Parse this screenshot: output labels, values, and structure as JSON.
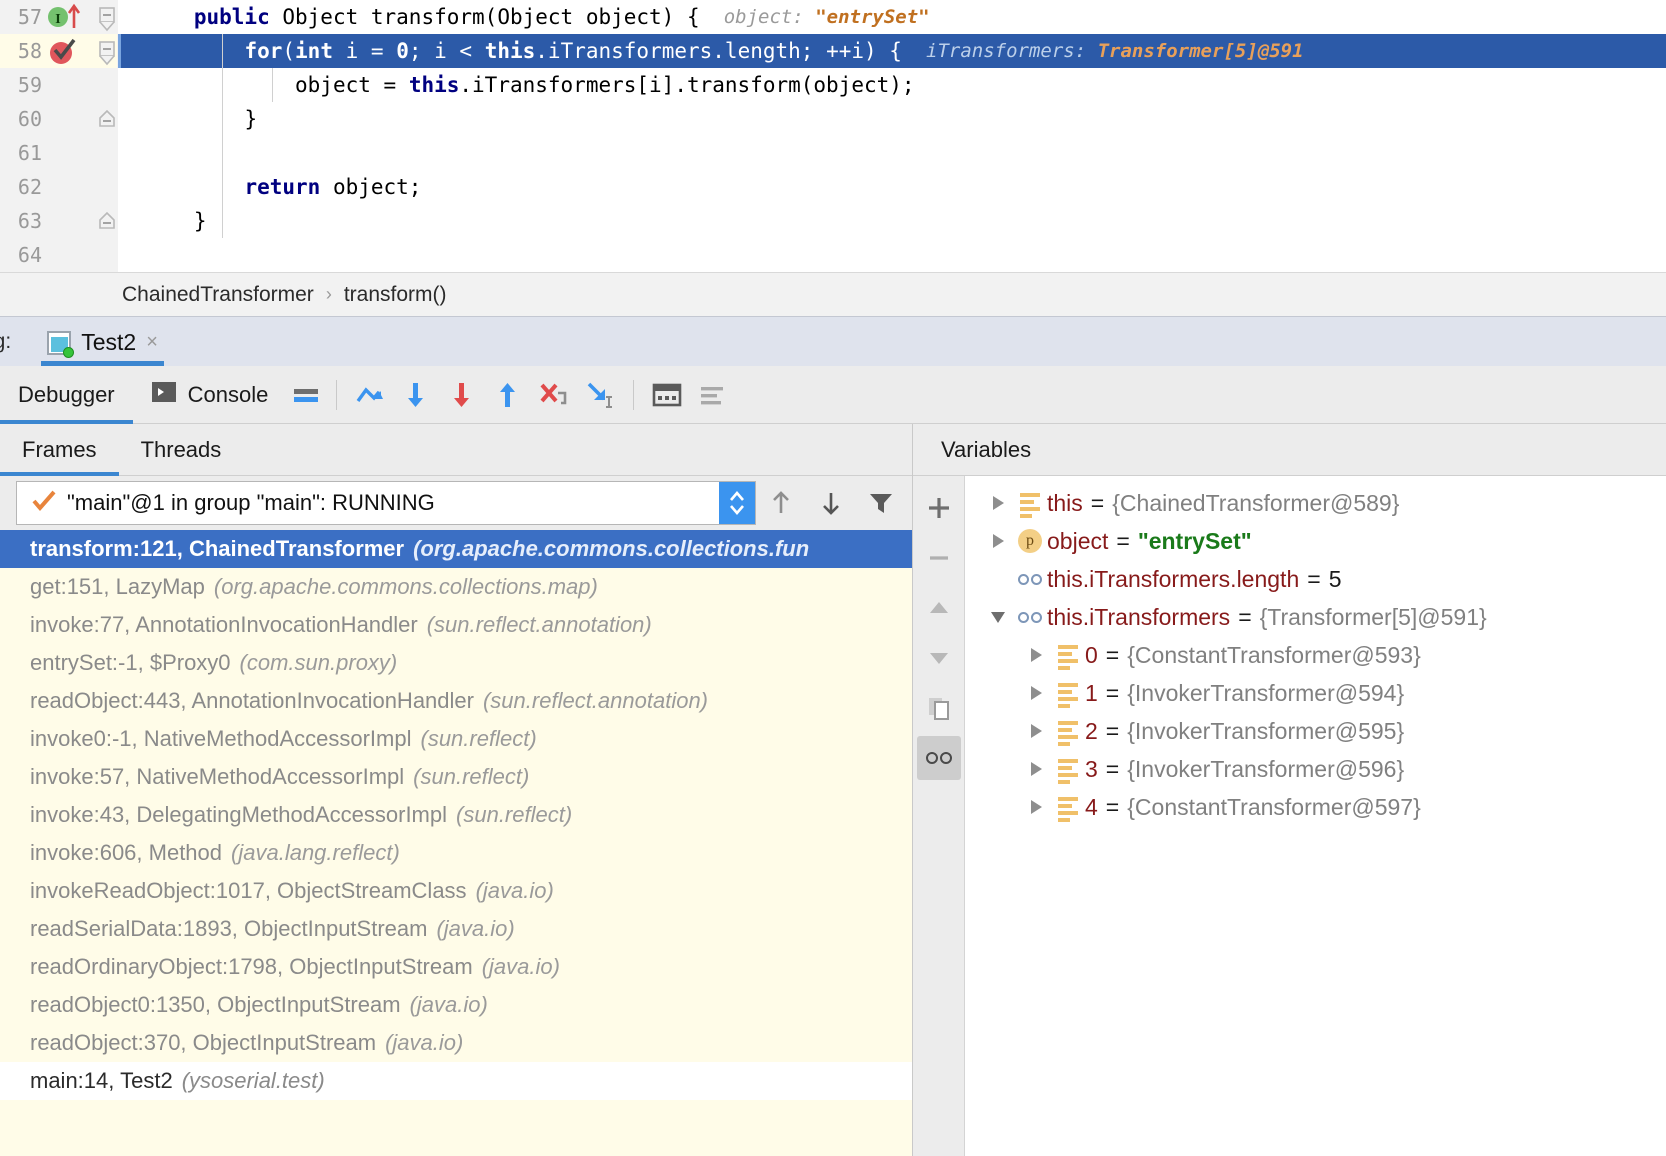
{
  "editor": {
    "lines": [
      {
        "no": "57",
        "exec": false,
        "selected": false,
        "indent": 0,
        "gutter_icon": "execution-point-icon",
        "segments": [
          {
            "t": "public ",
            "c": "kw"
          },
          {
            "t": "Object transform(",
            "c": ""
          },
          {
            "t": "Object",
            "c": ""
          },
          {
            "t": " object) { ",
            "c": ""
          }
        ],
        "inlay_label": "object:",
        "inlay_value": "\"entrySet\""
      },
      {
        "no": "58",
        "exec": true,
        "selected": true,
        "indent": 1,
        "gutter_icon": "breakpoint-verified-icon",
        "segments": [
          {
            "t": "for",
            "c": "kw"
          },
          {
            "t": "(",
            "c": ""
          },
          {
            "t": "int",
            "c": "kw"
          },
          {
            "t": " i = ",
            "c": ""
          },
          {
            "t": "0",
            "c": "kw"
          },
          {
            "t": "; i < ",
            "c": ""
          },
          {
            "t": "this",
            "c": "kw"
          },
          {
            "t": ".iTransformers.length; ++i) { ",
            "c": ""
          }
        ],
        "inlay_label": "iTransformers:",
        "inlay_value": "Transformer[5]@591"
      },
      {
        "no": "59",
        "exec": false,
        "selected": false,
        "indent": 2,
        "gutter_icon": "",
        "segments": [
          {
            "t": "object = ",
            "c": ""
          },
          {
            "t": "this",
            "c": "kw"
          },
          {
            "t": ".iTransformers[i].transform(object);",
            "c": ""
          }
        ],
        "inlay_label": "",
        "inlay_value": ""
      },
      {
        "no": "60",
        "exec": false,
        "selected": false,
        "indent": 1,
        "gutter_icon": "fold-collapse-icon",
        "segments": [
          {
            "t": "}",
            "c": ""
          }
        ],
        "inlay_label": "",
        "inlay_value": ""
      },
      {
        "no": "61",
        "exec": false,
        "selected": false,
        "indent": 0,
        "gutter_icon": "",
        "segments": [],
        "inlay_label": "",
        "inlay_value": ""
      },
      {
        "no": "62",
        "exec": false,
        "selected": false,
        "indent": 1,
        "gutter_icon": "",
        "segments": [
          {
            "t": "return",
            "c": "kw"
          },
          {
            "t": " object;",
            "c": ""
          }
        ],
        "inlay_label": "",
        "inlay_value": ""
      },
      {
        "no": "63",
        "exec": false,
        "selected": false,
        "indent": 0,
        "gutter_icon": "fold-collapse-icon",
        "segments": [
          {
            "t": "}",
            "c": ""
          }
        ],
        "inlay_label": "",
        "inlay_value": ""
      },
      {
        "no": "64",
        "exec": false,
        "selected": false,
        "indent": 0,
        "gutter_icon": "",
        "segments": [],
        "inlay_label": "",
        "inlay_value": ""
      }
    ]
  },
  "breadcrumb": {
    "class_name": "ChainedTransformer",
    "separator": "›",
    "method_name": "transform()"
  },
  "debug_tabbar": {
    "label": "ug:",
    "tab_title": "Test2",
    "close_glyph": "×"
  },
  "toolbar": {
    "tabs": [
      {
        "label": "Debugger",
        "active": true
      },
      {
        "label": "Console",
        "active": false
      }
    ],
    "buttons": [
      {
        "name": "mute-breakpoints-button",
        "title": "Mute Breakpoints"
      },
      {
        "name": "step-over-button",
        "title": "Step Over"
      },
      {
        "name": "step-into-button",
        "title": "Step Into"
      },
      {
        "name": "force-step-into-button",
        "title": "Force Step Into"
      },
      {
        "name": "step-out-button",
        "title": "Step Out"
      },
      {
        "name": "drop-frame-button",
        "title": "Drop Frame"
      },
      {
        "name": "run-to-cursor-button",
        "title": "Run to Cursor"
      },
      {
        "name": "evaluate-expression-button",
        "title": "Evaluate Expression"
      },
      {
        "name": "settings-button",
        "title": "Settings"
      }
    ]
  },
  "frames_pane": {
    "tabs": [
      {
        "label": "Frames",
        "active": true
      },
      {
        "label": "Threads",
        "active": false
      }
    ],
    "thread_selector": {
      "value": "\"main\"@1 in group \"main\": RUNNING"
    },
    "thread_buttons": [
      {
        "name": "frames-up-button"
      },
      {
        "name": "frames-down-button"
      },
      {
        "name": "frames-filter-button"
      }
    ],
    "frames": [
      {
        "method": "transform:121, ChainedTransformer",
        "pkg": "(org.apache.commons.collections.fun",
        "selected": true,
        "last": false
      },
      {
        "method": "get:151, LazyMap",
        "pkg": "(org.apache.commons.collections.map)",
        "selected": false,
        "last": false
      },
      {
        "method": "invoke:77, AnnotationInvocationHandler",
        "pkg": "(sun.reflect.annotation)",
        "selected": false,
        "last": false
      },
      {
        "method": "entrySet:-1, $Proxy0",
        "pkg": "(com.sun.proxy)",
        "selected": false,
        "last": false
      },
      {
        "method": "readObject:443, AnnotationInvocationHandler",
        "pkg": "(sun.reflect.annotation)",
        "selected": false,
        "last": false
      },
      {
        "method": "invoke0:-1, NativeMethodAccessorImpl",
        "pkg": "(sun.reflect)",
        "selected": false,
        "last": false
      },
      {
        "method": "invoke:57, NativeMethodAccessorImpl",
        "pkg": "(sun.reflect)",
        "selected": false,
        "last": false
      },
      {
        "method": "invoke:43, DelegatingMethodAccessorImpl",
        "pkg": "(sun.reflect)",
        "selected": false,
        "last": false
      },
      {
        "method": "invoke:606, Method",
        "pkg": "(java.lang.reflect)",
        "selected": false,
        "last": false
      },
      {
        "method": "invokeReadObject:1017, ObjectStreamClass",
        "pkg": "(java.io)",
        "selected": false,
        "last": false
      },
      {
        "method": "readSerialData:1893, ObjectInputStream",
        "pkg": "(java.io)",
        "selected": false,
        "last": false
      },
      {
        "method": "readOrdinaryObject:1798, ObjectInputStream",
        "pkg": "(java.io)",
        "selected": false,
        "last": false
      },
      {
        "method": "readObject0:1350, ObjectInputStream",
        "pkg": "(java.io)",
        "selected": false,
        "last": false
      },
      {
        "method": "readObject:370, ObjectInputStream",
        "pkg": "(java.io)",
        "selected": false,
        "last": false
      },
      {
        "method": "main:14, Test2",
        "pkg": "(ysoserial.test)",
        "selected": false,
        "last": true
      }
    ]
  },
  "vars_pane": {
    "title": "Variables",
    "sidebar_buttons": [
      {
        "name": "add-watch-button",
        "glyph": "+",
        "active": false
      },
      {
        "name": "remove-watch-button",
        "glyph": "−",
        "active": false
      },
      {
        "name": "move-watch-up-button",
        "glyph": "up",
        "active": false
      },
      {
        "name": "move-watch-down-button",
        "glyph": "down",
        "active": false
      },
      {
        "name": "copy-value-button",
        "glyph": "copy",
        "active": false
      },
      {
        "name": "inspect-button",
        "glyph": "glasses",
        "active": true
      }
    ],
    "variables": [
      {
        "indent": 0,
        "twisty": "right",
        "icon": "field-icon",
        "name": "this",
        "eq": "=",
        "value": "{ChainedTransformer@589}",
        "vtype": "obj"
      },
      {
        "indent": 0,
        "twisty": "right",
        "icon": "parameter-icon",
        "name": "object",
        "eq": "=",
        "value": "\"entrySet\"",
        "vtype": "str"
      },
      {
        "indent": 0,
        "twisty": "none",
        "icon": "watch-icon",
        "name": "this.iTransformers.length",
        "eq": "=",
        "value": "5",
        "vtype": "num"
      },
      {
        "indent": 0,
        "twisty": "down",
        "icon": "watch-icon",
        "name": "this.iTransformers",
        "eq": "=",
        "value": "{Transformer[5]@591}",
        "vtype": "obj"
      },
      {
        "indent": 1,
        "twisty": "right",
        "icon": "field-icon",
        "name": "0",
        "eq": "=",
        "value": "{ConstantTransformer@593}",
        "vtype": "obj"
      },
      {
        "indent": 1,
        "twisty": "right",
        "icon": "field-icon",
        "name": "1",
        "eq": "=",
        "value": "{InvokerTransformer@594}",
        "vtype": "obj"
      },
      {
        "indent": 1,
        "twisty": "right",
        "icon": "field-icon",
        "name": "2",
        "eq": "=",
        "value": "{InvokerTransformer@595}",
        "vtype": "obj"
      },
      {
        "indent": 1,
        "twisty": "right",
        "icon": "field-icon",
        "name": "3",
        "eq": "=",
        "value": "{InvokerTransformer@596}",
        "vtype": "obj"
      },
      {
        "indent": 1,
        "twisty": "right",
        "icon": "field-icon",
        "name": "4",
        "eq": "=",
        "value": "{ConstantTransformer@597}",
        "vtype": "obj"
      }
    ]
  },
  "colors": {
    "selection_blue": "#2c5aa8",
    "frame_selected": "#3b6fc4",
    "frames_bg": "#fffce8",
    "accent": "#3b86d0",
    "var_name": "#871a1a",
    "string_green": "#1a7a1a",
    "inlay_value": "#c07020"
  }
}
